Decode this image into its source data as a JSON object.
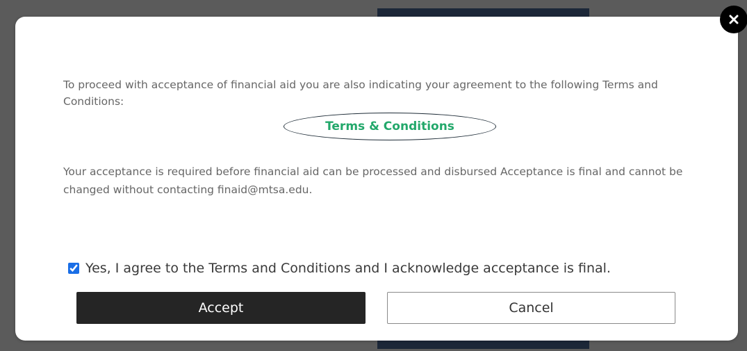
{
  "modal": {
    "intro_text": "To proceed with acceptance of financial aid you are also indicating your agreement to the following Terms and Conditions:",
    "terms_link_label": "Terms & Conditions",
    "acceptance_text": "Your acceptance is required before financial aid can be processed and disbursed Acceptance is final and cannot be changed without contacting finaid@mtsa.edu.",
    "agree_checkbox": {
      "label": "Yes, I agree to the Terms and Conditions and I acknowledge acceptance is final.",
      "checked": true
    },
    "accept_button_label": "Accept",
    "cancel_button_label": "Cancel",
    "close_icon": "close-icon"
  },
  "colors": {
    "link_green": "#23a86b",
    "accept_bg": "#252525",
    "checkbox_blue": "#1a6ee6",
    "body_text": "#666666"
  }
}
